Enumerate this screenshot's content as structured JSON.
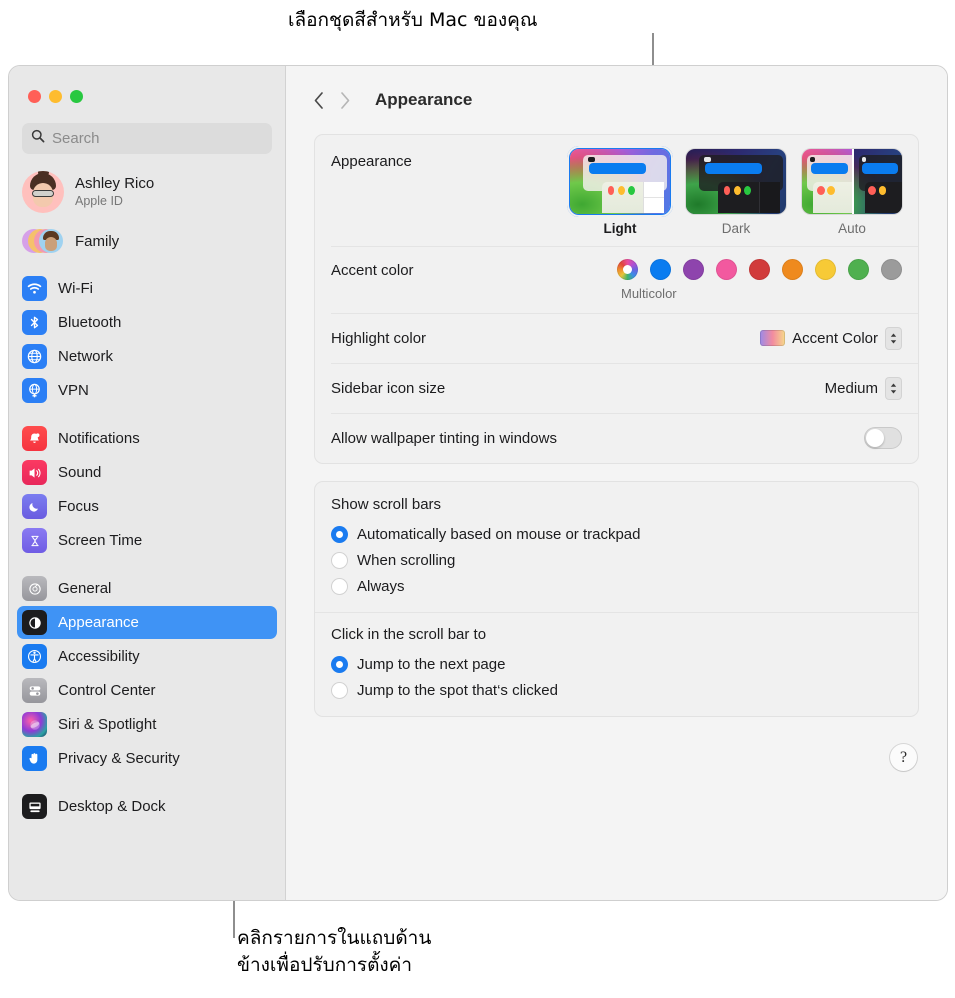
{
  "callouts": {
    "top": "เลือกชุดสีสำหรับ Mac ของคุณ",
    "bottom": "คลิกรายการในแถบด้าน\nข้างเพื่อปรับการตั้งค่า"
  },
  "window": {
    "traffic_lights": [
      "close-red",
      "minimize-yellow",
      "zoom-green"
    ],
    "colors": {
      "accent_blue": "#1a7bf0",
      "selected_sidebar": "#3f93f5",
      "sidebar_bg": "#e8e8e8",
      "content_bg": "#f4f4f4",
      "traffic_red": "#ff5f57",
      "traffic_yellow": "#febc2e",
      "traffic_green": "#28c840"
    }
  },
  "sidebar": {
    "search": {
      "placeholder": "Search",
      "value": ""
    },
    "account": {
      "name": "Ashley Rico",
      "subtitle": "Apple ID"
    },
    "family": {
      "label": "Family"
    },
    "groups": [
      {
        "items": [
          {
            "label": "Wi-Fi",
            "icon": "wifi-icon"
          },
          {
            "label": "Bluetooth",
            "icon": "bluetooth-icon"
          },
          {
            "label": "Network",
            "icon": "network-icon"
          },
          {
            "label": "VPN",
            "icon": "vpn-icon"
          }
        ]
      },
      {
        "items": [
          {
            "label": "Notifications",
            "icon": "notifications-icon"
          },
          {
            "label": "Sound",
            "icon": "sound-icon"
          },
          {
            "label": "Focus",
            "icon": "focus-icon"
          },
          {
            "label": "Screen Time",
            "icon": "screen-time-icon"
          }
        ]
      },
      {
        "items": [
          {
            "label": "General",
            "icon": "general-icon"
          },
          {
            "label": "Appearance",
            "icon": "appearance-icon",
            "selected": true
          },
          {
            "label": "Accessibility",
            "icon": "accessibility-icon"
          },
          {
            "label": "Control Center",
            "icon": "control-center-icon"
          },
          {
            "label": "Siri & Spotlight",
            "icon": "siri-icon"
          },
          {
            "label": "Privacy & Security",
            "icon": "privacy-icon"
          }
        ]
      },
      {
        "items": [
          {
            "label": "Desktop & Dock",
            "icon": "desktop-dock-icon"
          }
        ]
      }
    ]
  },
  "toolbar": {
    "back": "‹",
    "forward": "›",
    "title": "Appearance"
  },
  "main": {
    "appearance": {
      "label": "Appearance",
      "options": [
        {
          "name": "Light",
          "selected": true
        },
        {
          "name": "Dark",
          "selected": false
        },
        {
          "name": "Auto",
          "selected": false
        }
      ]
    },
    "accent": {
      "label": "Accent color",
      "caption": "Multicolor",
      "swatches": [
        {
          "name": "Multicolor",
          "color": "multicolor",
          "selected": true
        },
        {
          "name": "Blue",
          "color": "#0a7cf0"
        },
        {
          "name": "Purple",
          "color": "#8e44ad"
        },
        {
          "name": "Pink",
          "color": "#f2599f"
        },
        {
          "name": "Red",
          "color": "#d13b3b"
        },
        {
          "name": "Orange",
          "color": "#ef8a1e"
        },
        {
          "name": "Yellow",
          "color": "#f7ca36"
        },
        {
          "name": "Green",
          "color": "#4fb04f"
        },
        {
          "name": "Graphite",
          "color": "#9b9b9b"
        }
      ]
    },
    "highlight": {
      "label": "Highlight color",
      "value": "Accent Color"
    },
    "sidebar_icon_size": {
      "label": "Sidebar icon size",
      "value": "Medium"
    },
    "wallpaper_tint": {
      "label": "Allow wallpaper tinting in windows",
      "enabled": false
    },
    "scroll_bars": {
      "title": "Show scroll bars",
      "options": [
        {
          "label": "Automatically based on mouse or trackpad",
          "selected": true
        },
        {
          "label": "When scrolling",
          "selected": false
        },
        {
          "label": "Always",
          "selected": false
        }
      ]
    },
    "scroll_click": {
      "title": "Click in the scroll bar to",
      "options": [
        {
          "label": "Jump to the next page",
          "selected": true
        },
        {
          "label": "Jump to the spot that‘s clicked",
          "selected": false
        }
      ]
    },
    "help": {
      "label": "?"
    }
  }
}
